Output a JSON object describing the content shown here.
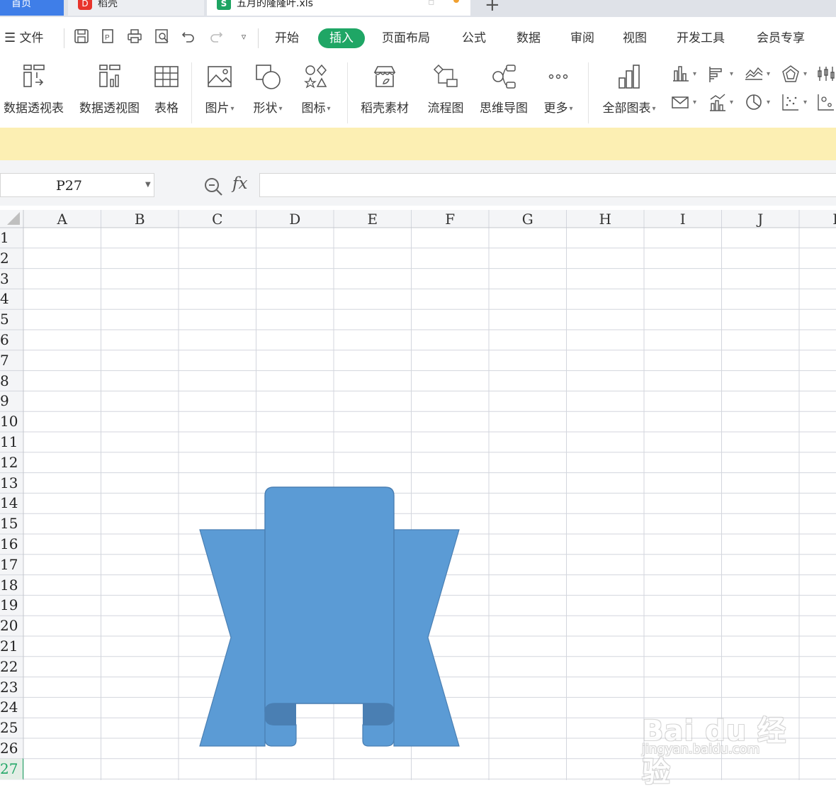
{
  "tabs": {
    "home": "首页",
    "daoke": "稻壳",
    "file": "五月的隆隆叶.xls",
    "add": "+"
  },
  "menu": {
    "file": "文件",
    "items": [
      "开始",
      "插入",
      "页面布局",
      "公式",
      "数据",
      "审阅",
      "视图",
      "开发工具",
      "会员专享"
    ],
    "active": "插入"
  },
  "ribbon": {
    "pivot_table": "数据透视表",
    "pivot_chart": "数据透视图",
    "table": "表格",
    "picture": "图片",
    "shape": "形状",
    "icon": "图标",
    "daoke_assets": "稻壳素材",
    "flowchart": "流程图",
    "mindmap": "思维导图",
    "more": "更多",
    "all_charts": "全部图表"
  },
  "formula_bar": {
    "cell_ref": "P27",
    "fx": "fx",
    "value": ""
  },
  "sheet": {
    "columns": [
      "A",
      "B",
      "C",
      "D",
      "E",
      "F",
      "G",
      "H",
      "I",
      "J",
      "K"
    ],
    "rows": [
      "1",
      "2",
      "3",
      "4",
      "5",
      "6",
      "7",
      "8",
      "9",
      "10",
      "11",
      "12",
      "13",
      "14",
      "15",
      "16",
      "17",
      "18",
      "19",
      "20",
      "21",
      "22",
      "23",
      "24",
      "25",
      "26",
      "27"
    ],
    "active_row": "27"
  },
  "colors": {
    "accent": "#1fa665",
    "shape_fill": "#5b9bd5",
    "shape_shadow": "#4a7fb3",
    "notice_bar": "#fcefb3",
    "tab_home": "#3f7ee8"
  },
  "watermark": {
    "brand": "Bai du 经验",
    "url": "jingyan.baidu.com"
  }
}
